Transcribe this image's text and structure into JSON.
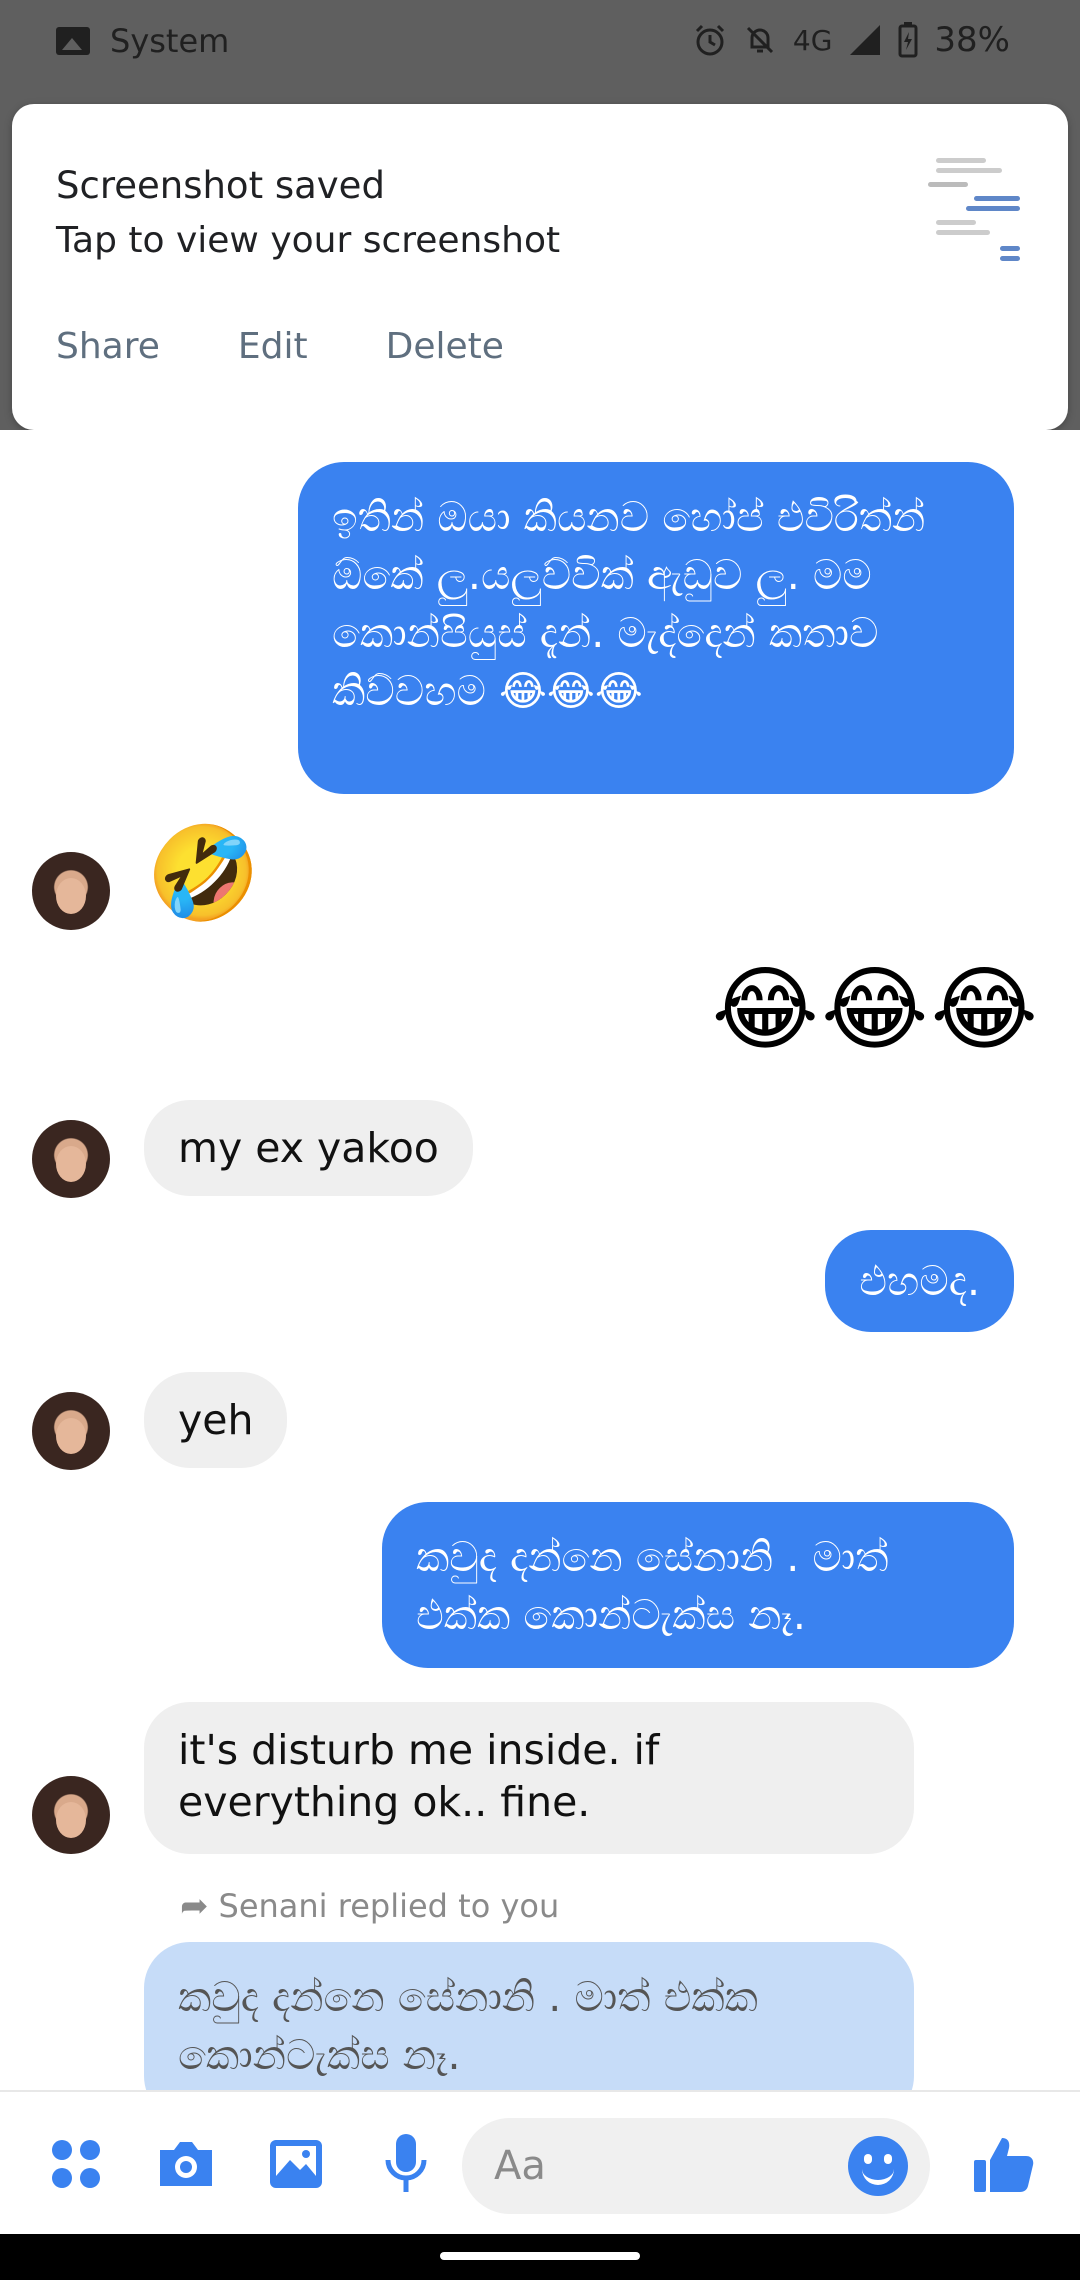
{
  "status_bar": {
    "app_label": "System",
    "network": "4G",
    "battery": "38%",
    "icons": [
      "image-icon",
      "alarm-icon",
      "bell-off-icon",
      "signal-icon",
      "battery-icon"
    ]
  },
  "notification": {
    "title": "Screenshot saved",
    "subtitle": "Tap to view your screenshot",
    "actions": [
      "Share",
      "Edit",
      "Delete"
    ]
  },
  "messages": {
    "m1": "ඉතින් ඔයා කියනව  හෝප් එවිරිත්න් ඕකේ ලු.යලුව්වික් ඇඩුව ලු. මම කොන්පියුස්  දැන්. මැද්දෙන් කතාව කිව්වහම 😂😂😂",
    "m2_emoji": "🤣",
    "m3_emoji": "😂😂😂",
    "m4": "my ex yakoo",
    "m5": "එහමද.",
    "m6": "yeh",
    "m7": "කවුද දන්නෙ සේනානි .  මාත් එක්ක කොන්ටැක්ස නෑ.",
    "m8": "it's disturb me inside. if everything ok.. fine.",
    "reply_meta": "Senani replied to you",
    "m9_quote": "කවුද දන්නෙ සේනානි .  මාත් එක්ක කොන්ටැක්ස නෑ."
  },
  "composer": {
    "placeholder": "Aa",
    "tools": [
      "menu-dots-icon",
      "camera-icon",
      "gallery-icon",
      "microphone-icon"
    ],
    "send_icon": "thumbs-up-icon"
  },
  "colors": {
    "outgoing_bubble": "#3a82f0",
    "incoming_bubble": "#efefef",
    "quoted_bubble": "#c6dcf8",
    "accent": "#3a82f0"
  }
}
